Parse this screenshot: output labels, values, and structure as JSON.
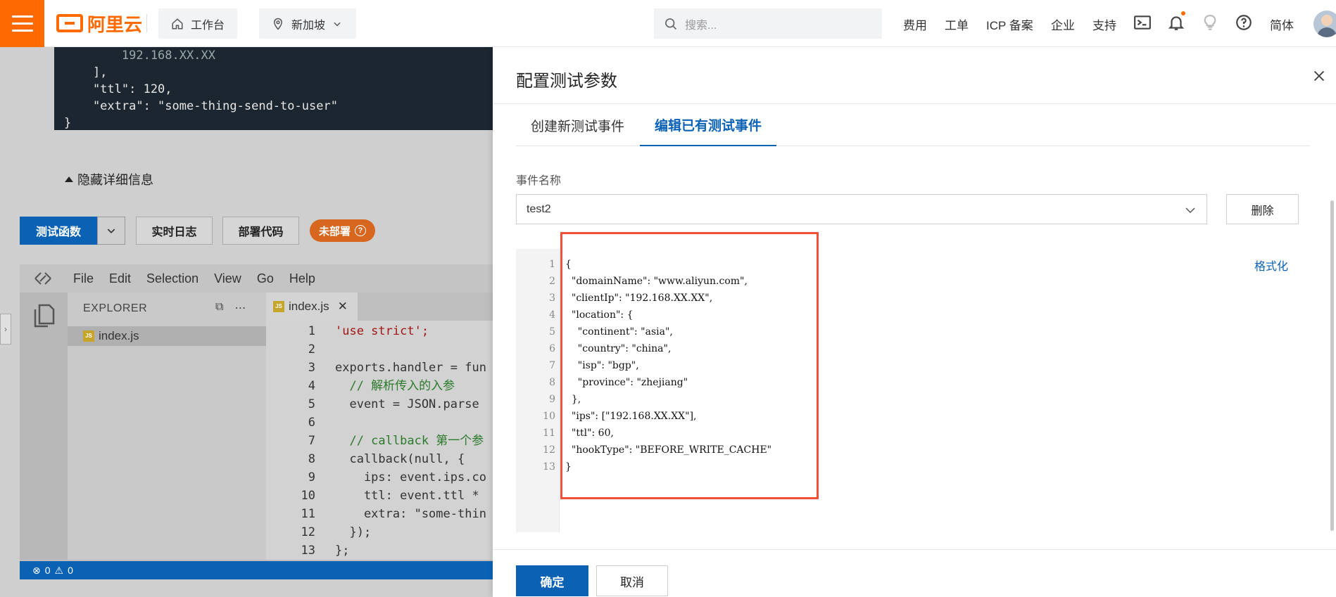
{
  "topbar": {
    "brand": "阿里云",
    "workbench_label": "工作台",
    "region_label": "新加坡",
    "search_placeholder": "搜索...",
    "nav": [
      "费用",
      "工单",
      "ICP 备案",
      "企业",
      "支持"
    ],
    "lang_label": "简体"
  },
  "background": {
    "code_lines": [
      "        192.168.XX.XX",
      "    ],",
      "    \"ttl\": 120,",
      "    \"extra\": \"some-thing-send-to-user\"",
      "}"
    ],
    "hide_detail_label": "隐藏详细信息",
    "buttons": {
      "test_function": "测试函数",
      "realtime_log": "实时日志",
      "deploy_code": "部署代码",
      "status": "未部署"
    },
    "ide": {
      "menu": [
        "File",
        "Edit",
        "Selection",
        "View",
        "Go",
        "Help"
      ],
      "explorer_title": "EXPLORER",
      "file_name": "index.js",
      "tab_name": "index.js",
      "lines": [
        {
          "n": "1",
          "t": "'use strict';"
        },
        {
          "n": "2",
          "t": ""
        },
        {
          "n": "3",
          "t": "exports.handler = fun"
        },
        {
          "n": "4",
          "t": "  // 解析传入的入参"
        },
        {
          "n": "5",
          "t": "  event = JSON.parse"
        },
        {
          "n": "6",
          "t": ""
        },
        {
          "n": "7",
          "t": "  // callback 第一个参"
        },
        {
          "n": "8",
          "t": "  callback(null, {"
        },
        {
          "n": "9",
          "t": "    ips: event.ips.co"
        },
        {
          "n": "10",
          "t": "    ttl: event.ttl *"
        },
        {
          "n": "11",
          "t": "    extra: \"some-thin"
        },
        {
          "n": "12",
          "t": "  });"
        },
        {
          "n": "13",
          "t": "};"
        }
      ],
      "errors": "0",
      "warnings": "0"
    }
  },
  "drawer": {
    "title": "配置测试参数",
    "tabs": [
      {
        "label": "创建新测试事件",
        "active": false
      },
      {
        "label": "编辑已有测试事件",
        "active": true
      }
    ],
    "event_name_label": "事件名称",
    "event_name_value": "test2",
    "delete_label": "删除",
    "format_label": "格式化",
    "json_lines": [
      "{",
      "  \"domainName\": \"www.aliyun.com\",",
      "  \"clientIp\": \"192.168.XX.XX\",",
      "  \"location\": {",
      "    \"continent\": \"asia\",",
      "    \"country\": \"china\",",
      "    \"isp\": \"bgp\",",
      "    \"province\": \"zhejiang\"",
      "  },",
      "  \"ips\": [\"192.168.XX.XX\"],",
      "  \"ttl\": 60,",
      "  \"hookType\": \"BEFORE_WRITE_CACHE\"",
      "}"
    ],
    "confirm_label": "确定",
    "cancel_label": "取消"
  },
  "colors": {
    "brand_orange": "#ff6a00",
    "primary_blue": "#0b62b5",
    "highlight_red": "#f0503a"
  }
}
